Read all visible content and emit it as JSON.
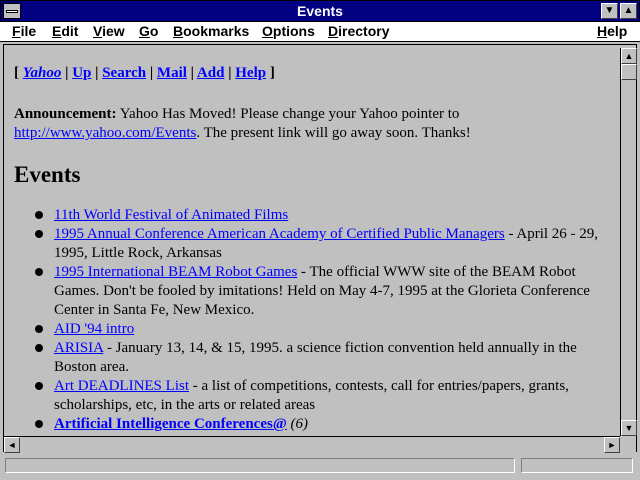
{
  "window": {
    "title": "Events"
  },
  "menubar": {
    "items": [
      {
        "label": "File"
      },
      {
        "label": "Edit"
      },
      {
        "label": "View"
      },
      {
        "label": "Go"
      },
      {
        "label": "Bookmarks"
      },
      {
        "label": "Options"
      },
      {
        "label": "Directory"
      }
    ],
    "help": "Help"
  },
  "nav": {
    "open": "[",
    "close": "]",
    "sep": "|",
    "links": [
      "Yahoo",
      "Up",
      "Search",
      "Mail",
      "Add",
      "Help"
    ]
  },
  "announcement": {
    "label": "Announcement:",
    "text1": " Yahoo Has Moved! Please change your Yahoo pointer to",
    "link": "http://www.yahoo.com/Events",
    "text2": ". The present link will go away soon. Thanks!"
  },
  "heading": "Events",
  "items": [
    {
      "link": "11th World Festival of Animated Films",
      "desc": ""
    },
    {
      "link": "1995 Annual Conference American Academy of Certified Public Managers",
      "desc": " - April 26 - 29, 1995, Little Rock, Arkansas"
    },
    {
      "link": "1995 International BEAM Robot Games",
      "desc": " - The official WWW site of the BEAM Robot Games. Don't be fooled by imitations! Held on May 4-7, 1995 at the Glorieta Conference Center in Santa Fe, New Mexico."
    },
    {
      "link": "AID '94 intro",
      "desc": ""
    },
    {
      "link": "ARISIA",
      "desc": " - January 13, 14, & 15, 1995. a science fiction convention held annually in the Boston area."
    },
    {
      "link": "Art DEADLINES List",
      "desc": " - a list of competitions, contests, call for entries/papers, grants, scholarships, etc, in the arts or related areas"
    },
    {
      "link": "Artificial Intelligence Conferences@",
      "desc": " (6)",
      "bold": true
    }
  ]
}
